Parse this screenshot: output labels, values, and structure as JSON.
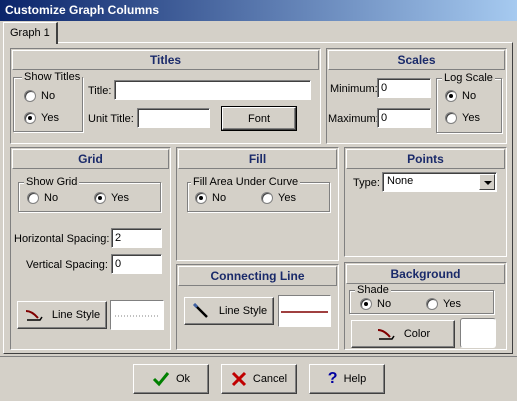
{
  "window": {
    "title": "Customize Graph Columns"
  },
  "tabs": [
    {
      "label": "Graph 1"
    }
  ],
  "titles": {
    "header": "Titles",
    "show_titles": {
      "label": "Show Titles",
      "no": "No",
      "yes": "Yes",
      "selected": "Yes"
    },
    "title_label": "Title:",
    "title_value": "",
    "unit_title_label": "Unit Title:",
    "unit_title_value": "",
    "font_button": "Font"
  },
  "scales": {
    "header": "Scales",
    "minimum_label": "Minimum:",
    "minimum_value": "0",
    "maximum_label": "Maximum:",
    "maximum_value": "0",
    "log_scale": {
      "label": "Log Scale",
      "no": "No",
      "yes": "Yes",
      "selected": "No"
    }
  },
  "grid": {
    "header": "Grid",
    "show_grid": {
      "label": "Show Grid",
      "no": "No",
      "yes": "Yes",
      "selected": "Yes"
    },
    "horizontal_spacing_label": "Horizontal Spacing:",
    "horizontal_spacing_value": "2",
    "vertical_spacing_label": "Vertical Spacing:",
    "vertical_spacing_value": "0",
    "line_style_button": "Line Style"
  },
  "fill": {
    "header": "Fill",
    "fill_area": {
      "label": "Fill Area Under Curve",
      "no": "No",
      "yes": "Yes",
      "selected": "No"
    }
  },
  "points": {
    "header": "Points",
    "type_label": "Type:",
    "type_value": "None"
  },
  "connecting_line": {
    "header": "Connecting Line",
    "line_style_button": "Line Style",
    "line_color": "#800000"
  },
  "background": {
    "header": "Background",
    "shade": {
      "label": "Shade",
      "no": "No",
      "yes": "Yes",
      "selected": "No"
    },
    "color_button": "Color",
    "color_value": "#ffffff"
  },
  "footer": {
    "ok": "Ok",
    "cancel": "Cancel",
    "help": "Help"
  },
  "colors": {
    "titlebar_start": "#0a246a",
    "titlebar_end": "#a6caf0",
    "header_text": "#1a2a6a",
    "ok_check": "#008000",
    "cancel_x": "#c00000",
    "help_q": "#0000a0"
  }
}
